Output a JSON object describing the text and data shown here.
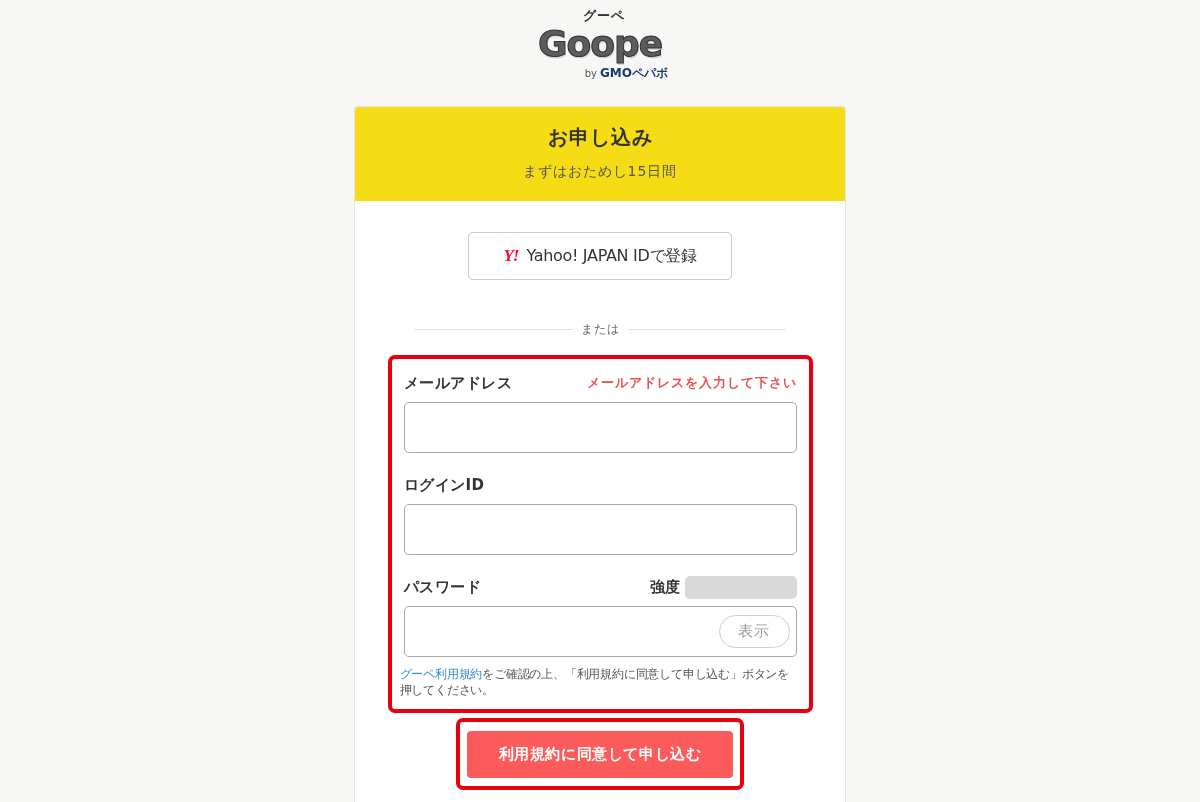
{
  "logo": {
    "kana": "グーペ",
    "wordmark": "Goope",
    "by": "by",
    "company": "GMOペパボ"
  },
  "card": {
    "title": "お申し込み",
    "subtitle": "まずはおためし15日間"
  },
  "yahoo_button": {
    "logo": "Y!",
    "label": "Yahoo! JAPAN IDで登録"
  },
  "divider": {
    "label": "または"
  },
  "form": {
    "highlighted": true,
    "fields": [
      {
        "kind": "text",
        "label": "メールアドレス",
        "error": "メールアドレスを入力して下さい"
      },
      {
        "kind": "text",
        "label": "ログインID"
      },
      {
        "kind": "password",
        "label": "パスワード",
        "strength_label": "強度",
        "strength": {
          "level": 0
        },
        "toggle": "表示"
      }
    ],
    "note": {
      "link": "グーペ利用規約",
      "text": "をご確認の上、「利用規約に同意して申し込む」ボタンを押してください。"
    }
  },
  "submit": {
    "label": "利用規約に同意して申し込む",
    "highlighted": true
  }
}
